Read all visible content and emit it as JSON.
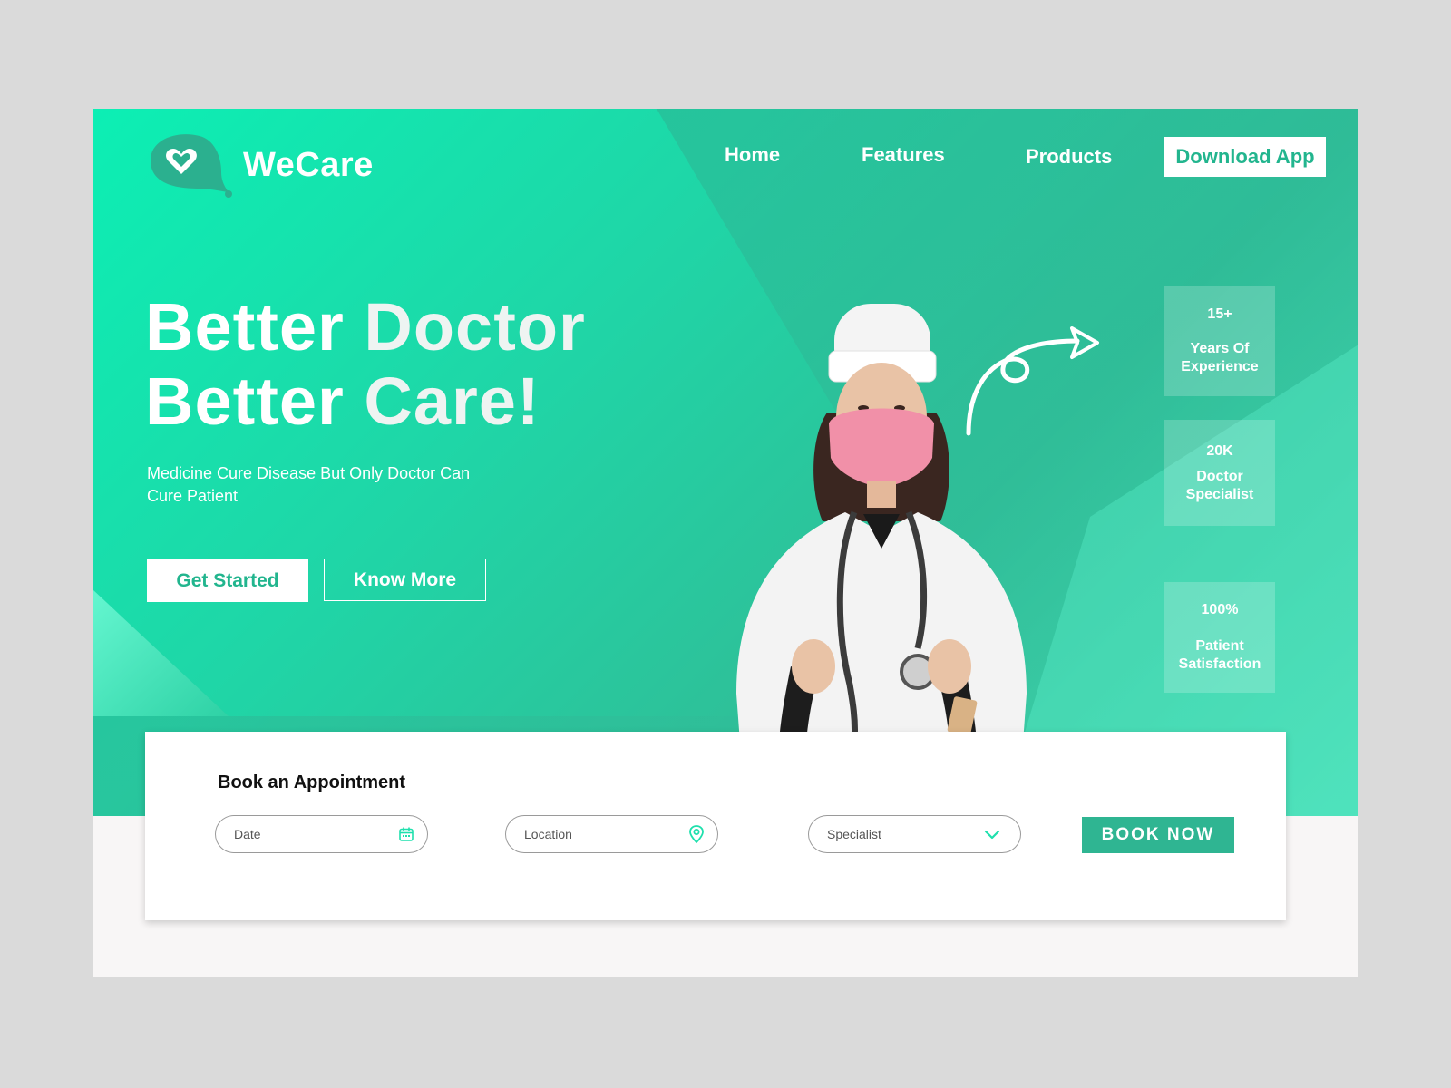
{
  "brand": {
    "name": "WeCare"
  },
  "nav": {
    "items": [
      {
        "label": "Home"
      },
      {
        "label": "Features"
      },
      {
        "label": "Products"
      }
    ],
    "cta_label": "Download App"
  },
  "hero": {
    "headline_line1_a": "Better",
    "headline_line1_b": "Doctor",
    "headline_line2_a": "Better",
    "headline_line2_b": "Care!",
    "tagline": "Medicine Cure Disease But Only Doctor Can Cure Patient",
    "primary_button": "Get Started",
    "secondary_button": "Know More"
  },
  "stats": [
    {
      "value": "15+",
      "label_line1": "Years Of",
      "label_line2": "Experience"
    },
    {
      "value": "20K",
      "label_line1": "Doctor",
      "label_line2": "Specialist"
    },
    {
      "value": "100%",
      "label_line1": "Patient",
      "label_line2": "Satisfaction"
    }
  ],
  "booking": {
    "title": "Book an Appointment",
    "date_placeholder": "Date",
    "location_placeholder": "Location",
    "specialist_placeholder": "Specialist",
    "submit_label": "BOOK NOW"
  },
  "colors": {
    "accent": "#2fb592",
    "hero_start": "#0cefb4",
    "hero_end": "#5ff5cf",
    "page_bg": "#dadada"
  },
  "icons": {
    "logo": "heart-pin-icon",
    "date": "calendar-icon",
    "location": "map-pin-icon",
    "specialist": "chevron-down-icon"
  }
}
